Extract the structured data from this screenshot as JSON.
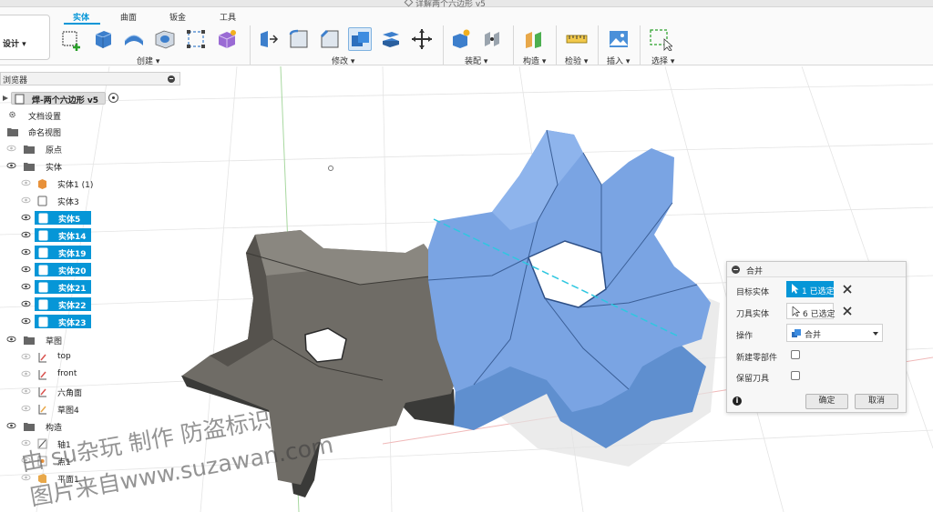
{
  "window": {
    "doc_title": "详解两个六边形 v5"
  },
  "toolbar": {
    "workspace_label": "设计 ▾",
    "tabs": [
      {
        "label": "实体",
        "active": true
      },
      {
        "label": "曲面",
        "active": false
      },
      {
        "label": "钣金",
        "active": false
      },
      {
        "label": "工具",
        "active": false
      }
    ],
    "groups": [
      {
        "label": "创建 ▾"
      },
      {
        "label": "修改 ▾"
      },
      {
        "label": "装配 ▾"
      },
      {
        "label": "构造 ▾"
      },
      {
        "label": "检验 ▾"
      },
      {
        "label": "插入 ▾"
      },
      {
        "label": "选择 ▾"
      }
    ],
    "accent_color": "#0696d7"
  },
  "browser": {
    "header_label": "浏览器",
    "root_label": "焊-两个六边形 v5",
    "items": [
      {
        "label": "文档设置"
      },
      {
        "label": "命名视图"
      },
      {
        "label": "原点"
      },
      {
        "label": "实体"
      },
      {
        "label": "实体1 (1)"
      },
      {
        "label": "实体3"
      },
      {
        "label": "实体5",
        "selected": true
      },
      {
        "label": "实体14",
        "selected": true
      },
      {
        "label": "实体19",
        "selected": true
      },
      {
        "label": "实体20",
        "selected": true
      },
      {
        "label": "实体21",
        "selected": true
      },
      {
        "label": "实体22",
        "selected": true
      },
      {
        "label": "实体23",
        "selected": true
      },
      {
        "label": "草图"
      },
      {
        "label": "top"
      },
      {
        "label": "front"
      },
      {
        "label": "六角面"
      },
      {
        "label": "草图4"
      },
      {
        "label": "构造"
      },
      {
        "label": "轴1"
      },
      {
        "label": "点1"
      },
      {
        "label": "平面1"
      }
    ]
  },
  "dialog": {
    "title": "合并",
    "target_label": "目标实体",
    "target_value": "1 已选定",
    "tool_label": "刀具实体",
    "tool_value": "6 已选定",
    "operation_label": "操作",
    "operation_value": "合并",
    "new_component_label": "新建零部件",
    "keep_tools_label": "保留刀具",
    "ok_label": "确定",
    "cancel_label": "取消"
  },
  "watermark": {
    "line1": "由 su杂玩 制作 防盗标识",
    "line2": "图片来自www.suzawan.com"
  }
}
